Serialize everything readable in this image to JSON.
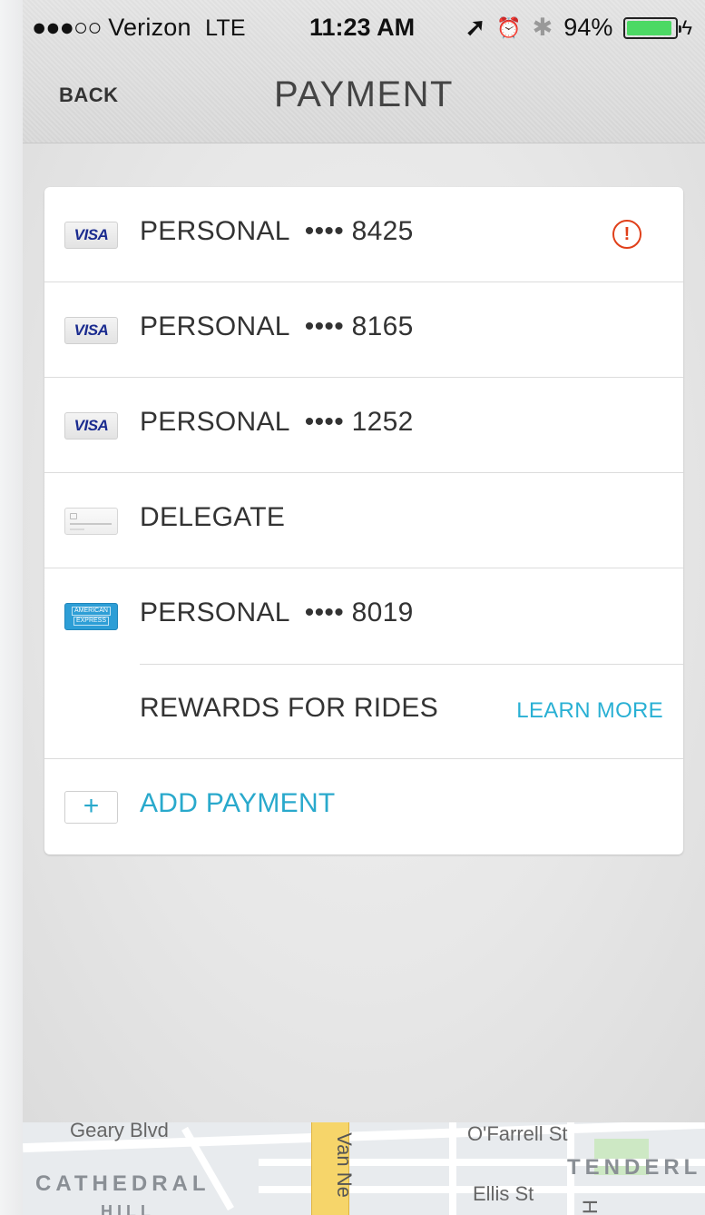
{
  "status_bar": {
    "signal": "●●●○○",
    "carrier": "Verizon",
    "network": "LTE",
    "time": "11:23 AM",
    "location_icon": "➚",
    "alarm_icon": "⏰",
    "bluetooth_icon": "✱",
    "battery_percent_text": "94%",
    "battery_level": 0.94,
    "charging_icon": "ϟ"
  },
  "nav": {
    "back_label": "BACK",
    "title": "PAYMENT"
  },
  "payments": [
    {
      "icon": "visa-card-icon",
      "brand_text": "VISA",
      "label": "PERSONAL",
      "digits": "•••• 8425",
      "alert_symbol": "!"
    },
    {
      "icon": "visa-card-icon",
      "brand_text": "VISA",
      "label": "PERSONAL",
      "digits": "•••• 8165"
    },
    {
      "icon": "visa-card-icon",
      "brand_text": "VISA",
      "label": "PERSONAL",
      "digits": "•••• 1252"
    },
    {
      "icon": "delegate-card-icon",
      "label": "DELEGATE"
    },
    {
      "icon": "amex-card-icon",
      "brand_text": [
        "AMERICAN",
        "EXPRESS"
      ],
      "label": "PERSONAL",
      "digits": "•••• 8019"
    }
  ],
  "rewards": {
    "label": "REWARDS FOR RIDES",
    "link": "LEARN MORE"
  },
  "add_payment": {
    "icon_symbol": "+",
    "label": "ADD PAYMENT"
  },
  "map": {
    "streets": {
      "geary": "Geary Blvd",
      "van_ness": "Van Ne",
      "ofarrell": "O'Farrell St",
      "ellis": "Ellis St",
      "h": "H"
    },
    "districts": {
      "cathedral": "CATHEDRAL",
      "hill": "HILL",
      "tenderloin": "TENDERL"
    },
    "colors": {
      "major_road": "#f6d56a",
      "park": "#cde8c4"
    }
  },
  "colors": {
    "accent": "#29a9cc",
    "alert": "#e0401a",
    "battery": "#4cd964"
  }
}
